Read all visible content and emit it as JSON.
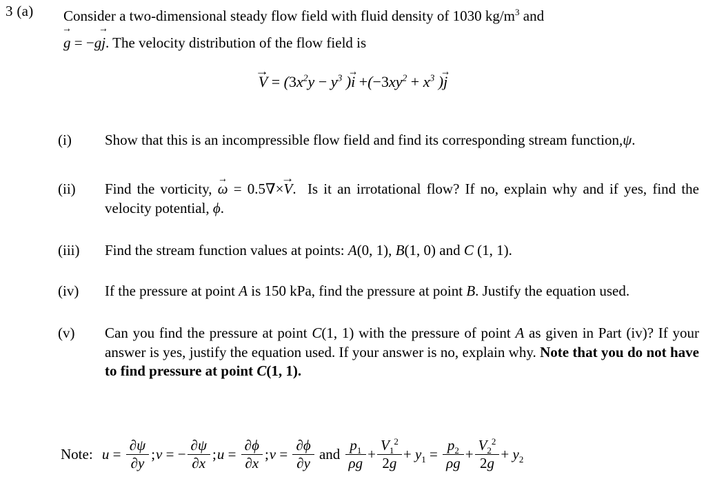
{
  "question": {
    "number_label": "3 (a)",
    "intro_line1_a": "Consider a two-dimensional steady flow field with fluid density of ",
    "density_value": "1030",
    "density_unit": "kg/m",
    "density_exponent": "3",
    "intro_line1_b": " and",
    "gravity_statement": {
      "g_vector": "g",
      "equals": "=",
      "minus": "−",
      "g_scalar": "g",
      "j_vector": "j",
      "period": ".",
      "rest": "The velocity distribution of the flow field is"
    },
    "velocity_equation": {
      "lhs": "V",
      "equals": "=",
      "open1": "(",
      "term1_coeff": "3",
      "term1_x": "x",
      "term1_x_exp": "2",
      "term1_y": "y",
      "minus": "−",
      "term2_y": "y",
      "term2_y_exp": "3",
      "close1": ")",
      "i_vector": "i",
      "plus": "+",
      "open2": "(",
      "term3_sign": "−",
      "term3_coeff": "3",
      "term3_x": "x",
      "term3_y": "y",
      "term3_y_exp": "2",
      "plus2": "+",
      "term4_x": "x",
      "term4_x_exp": "3",
      "close2": ")",
      "j_vector": "j"
    }
  },
  "parts": [
    {
      "marker": "(i)",
      "text_a": "Show that this is an incompressible flow field and find its corresponding stream function,",
      "symbol": "ψ",
      "text_b": "."
    },
    {
      "marker": "(ii)",
      "text_a": "Find the vorticity,",
      "omega": "ω",
      "equals": "=",
      "value": "0.5",
      "nabla": "∇",
      "times": "×",
      "V": "V",
      "period": ".",
      "text_b": "Is it an irrotational flow? If no, explain why and if yes, find the velocity potential,",
      "symbol": "ϕ",
      "text_c": "."
    },
    {
      "marker": "(iii)",
      "text_a": "Find the stream function  values at points: ",
      "point_A": "A",
      "point_A_coords": "(0, 1), ",
      "point_B": "B",
      "point_B_coords": "(1, 0) and ",
      "point_C": "C",
      "point_C_coords": " (1, 1)."
    },
    {
      "marker": "(iv)",
      "text_a": "If the pressure at point ",
      "point_A": "A",
      "text_b": " is 150 kPa, find the pressure at point ",
      "point_B": "B",
      "text_c": ". Justify the equation used."
    },
    {
      "marker": "(v)",
      "text_a": "Can you find the pressure at point ",
      "point_C": "C",
      "text_b": "(1, 1) with the pressure of point ",
      "point_A": "A",
      "text_c": " as given in Part (iv)? If your answer is yes, justify the equation used. If your answer is no, explain why. ",
      "bold_a": "Note that you do not have to find pressure at point ",
      "bold_C": "C",
      "bold_b": "(1, 1)."
    }
  ],
  "note": {
    "label": "Note:",
    "u1": "u",
    "eq1": "=",
    "psi1": "ψ",
    "partial": "∂",
    "y1": "y",
    "sep1": ";",
    "v1": "v",
    "eq2": "=",
    "minus": "−",
    "psi2": "ψ",
    "x1": "x",
    "sep2": ";",
    "u2": "u",
    "eq3": "=",
    "phi1": "ϕ",
    "x2": "x",
    "sep3": ";",
    "v2": "v",
    "eq4": "=",
    "phi2": "ϕ",
    "y2": "y",
    "and": "and",
    "bernoulli": {
      "p1": "p",
      "p1_sub": "1",
      "rho": "ρ",
      "g1": "g",
      "plus1": "+",
      "V1": "V",
      "V1_sub": "1",
      "V1_sup": "2",
      "two_g1": "2",
      "g2": "g",
      "plus2": "+",
      "y1": "y",
      "y1_sub": "1",
      "equals": "=",
      "p2": "p",
      "p2_sub": "2",
      "rho2": "ρ",
      "g3": "g",
      "plus3": "+",
      "V2": "V",
      "V2_sub": "2",
      "V2_sup": "2",
      "two_g2": "2",
      "g4": "g",
      "plus4": "+",
      "y2": "y",
      "y2_sub": "2"
    }
  },
  "colors": {
    "background": "#ffffff",
    "text": "#000000"
  }
}
